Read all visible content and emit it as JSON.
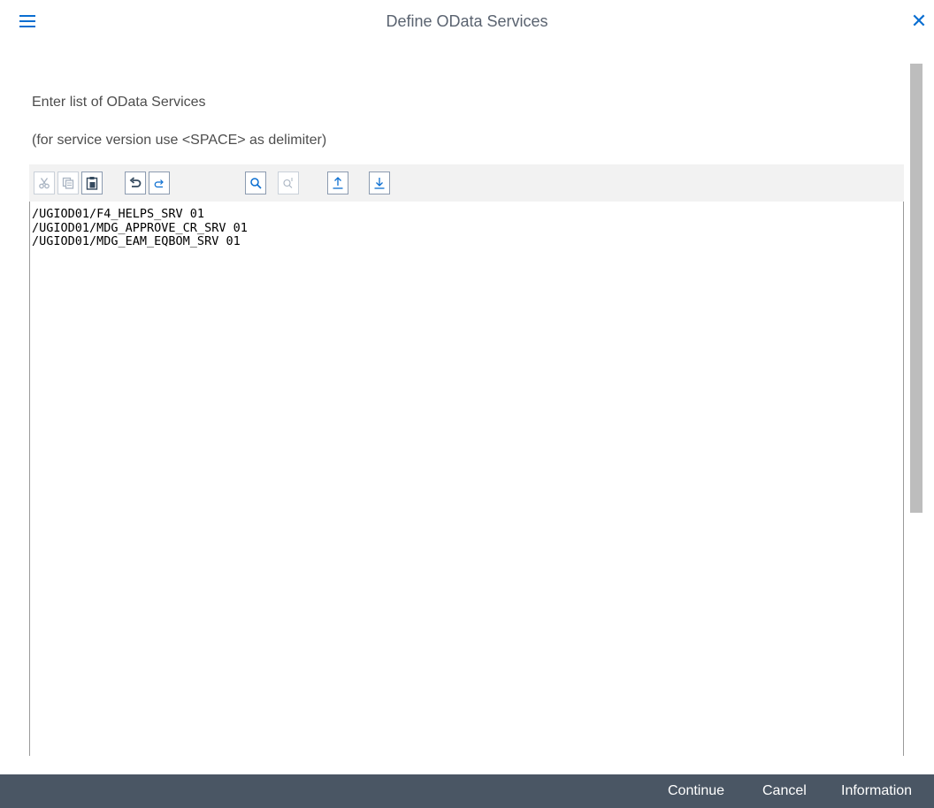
{
  "dialog": {
    "title": "Define OData Services",
    "menu_icon": "hamburger-menu-icon",
    "close_icon": "close-icon"
  },
  "content": {
    "instruction": "Enter list of OData Services",
    "hint": "(for service version use <SPACE> as delimiter)"
  },
  "toolbar": {
    "buttons": [
      {
        "icon": "cut-icon",
        "enabled": false
      },
      {
        "icon": "copy-icon",
        "enabled": false
      },
      {
        "icon": "paste-icon",
        "enabled": true
      },
      {
        "icon": "undo-icon",
        "enabled": true
      },
      {
        "icon": "redo-icon",
        "enabled": true
      },
      {
        "icon": "search-icon",
        "enabled": true
      },
      {
        "icon": "search-next-icon",
        "enabled": false
      },
      {
        "icon": "upload-icon",
        "enabled": true
      },
      {
        "icon": "download-icon",
        "enabled": true
      }
    ]
  },
  "editor": {
    "lines": [
      "/UGIOD01/F4_HELPS_SRV 01",
      "/UGIOD01/MDG_APPROVE_CR_SRV 01",
      "/UGIOD01/MDG_EAM_EQBOM_SRV 01"
    ]
  },
  "footer": {
    "continue_label": "Continue",
    "cancel_label": "Cancel",
    "information_label": "Information"
  },
  "colors": {
    "accent": "#0a6ed1",
    "footer_bg": "#4a5664",
    "toolbar_bg": "#f2f2f2"
  }
}
